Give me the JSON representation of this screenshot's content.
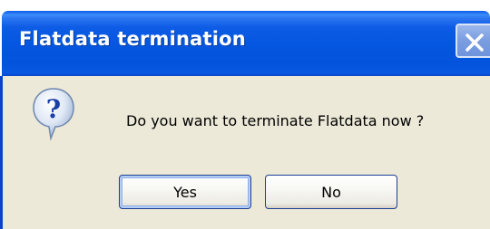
{
  "dialog": {
    "title": "Flatdata termination",
    "message": "Do you want to terminate Flatdata now ?",
    "icon": "question-icon",
    "buttons": {
      "yes_label": "Yes",
      "no_label": "No"
    }
  },
  "colors": {
    "titlebar": "#0556e0",
    "body": "#ece9d8",
    "close_button": "#7a9de0"
  }
}
